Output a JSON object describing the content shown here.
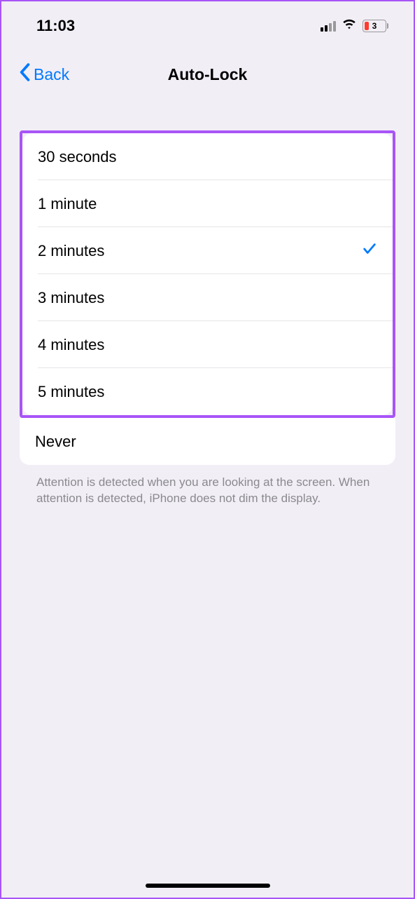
{
  "statusBar": {
    "time": "11:03",
    "batteryLevel": "3"
  },
  "navBar": {
    "backLabel": "Back",
    "title": "Auto-Lock"
  },
  "options": [
    {
      "label": "30 seconds",
      "selected": false
    },
    {
      "label": "1 minute",
      "selected": false
    },
    {
      "label": "2 minutes",
      "selected": true
    },
    {
      "label": "3 minutes",
      "selected": false
    },
    {
      "label": "4 minutes",
      "selected": false
    },
    {
      "label": "5 minutes",
      "selected": false
    }
  ],
  "neverOption": {
    "label": "Never",
    "selected": false
  },
  "footerText": "Attention is detected when you are looking at the screen. When attention is detected, iPhone does not dim the display."
}
